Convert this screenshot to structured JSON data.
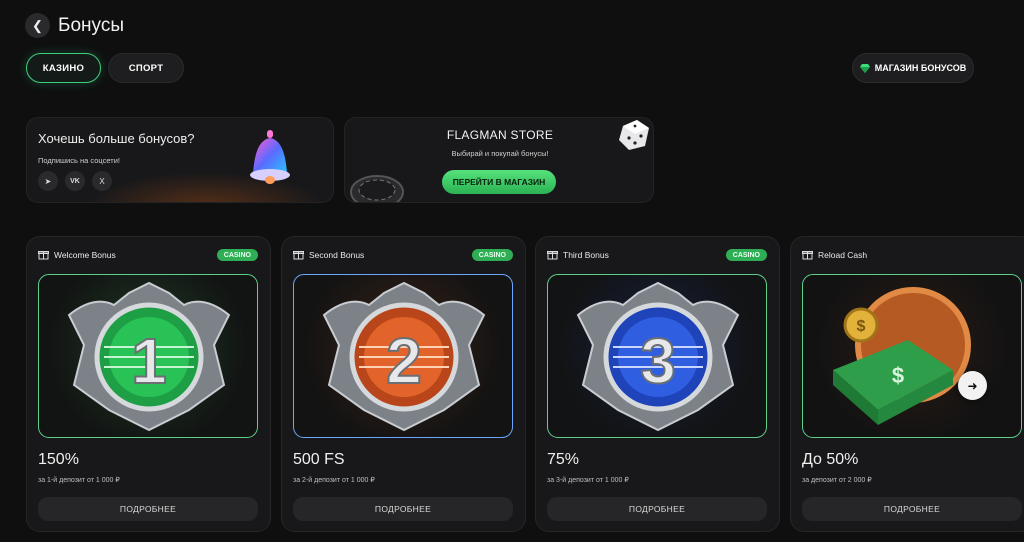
{
  "header": {
    "back_icon": "chevron-left-icon",
    "title": "Бонусы"
  },
  "tabs": [
    {
      "label": "КАЗИНО",
      "active": true
    },
    {
      "label": "СПОРТ",
      "active": false
    }
  ],
  "shop_button": {
    "label": "МАГАЗИН БОНУСОВ",
    "icon": "gem-icon"
  },
  "promo_social": {
    "title": "Хочешь больше бонусов?",
    "subtitle": "Подпишись на соцсети!",
    "socials": [
      {
        "icon": "telegram-icon",
        "glyph": "➤"
      },
      {
        "icon": "vk-icon",
        "glyph": "VK"
      },
      {
        "icon": "x-icon",
        "glyph": "X"
      }
    ]
  },
  "promo_store": {
    "title": "FLAGMAN STORE",
    "subtitle": "Выбирай и покупай бонусы!",
    "button": "ПЕРЕЙТИ В МАГАЗИН"
  },
  "cards": [
    {
      "name": "Welcome Bonus",
      "badge": "CASINO",
      "number": "1",
      "value": "150%",
      "desc": "за 1-й депозит от 1 000 ₽",
      "button": "ПОДРОБНЕЕ",
      "accent": "#27c25a"
    },
    {
      "name": "Second Bonus",
      "badge": "CASINO",
      "number": "2",
      "value": "500 FS",
      "desc": "за 2-й депозит от 1 000 ₽",
      "button": "ПОДРОБНЕЕ",
      "accent": "#e0601f"
    },
    {
      "name": "Third Bonus",
      "badge": "CASINO",
      "number": "3",
      "value": "75%",
      "desc": "за 3-й депозит от 1 000 ₽",
      "button": "ПОДРОБНЕЕ",
      "accent": "#2f5fe0"
    },
    {
      "name": "Reload Cash",
      "badge": "",
      "number": "",
      "value": "До 50%",
      "desc": "за депозит от 2 000 ₽",
      "button": "ПОДРОБНЕЕ",
      "accent": "#c06a2a"
    }
  ],
  "carousel_next_icon": "arrow-right-icon",
  "colors": {
    "background": "#0f0f10",
    "accent_green": "#3bd07a",
    "card_bg": "#18181a"
  }
}
